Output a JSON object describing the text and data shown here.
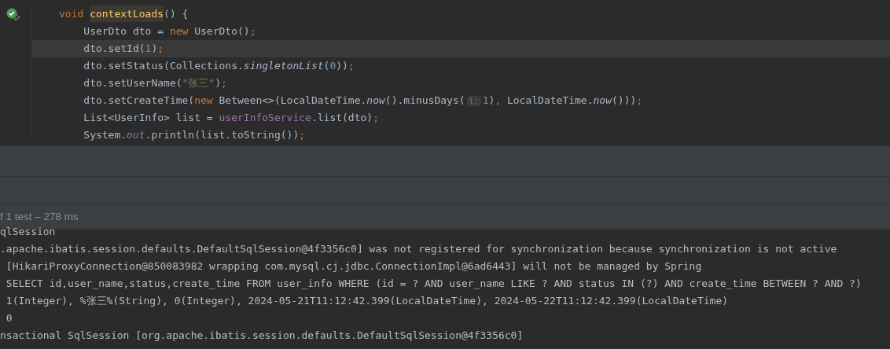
{
  "editor": {
    "gutter_icon": {
      "passed": true
    },
    "lines": [
      {
        "current": false,
        "tokens": [
          {
            "kind": "keyword",
            "text": "void "
          },
          {
            "kind": "highlight",
            "text": "contextLoads"
          },
          {
            "kind": "plain",
            "text": "() {"
          }
        ]
      },
      {
        "current": false,
        "tokens": [
          {
            "kind": "plain",
            "text": "    UserDto dto = "
          },
          {
            "kind": "keyword",
            "text": "new "
          },
          {
            "kind": "plain",
            "text": "UserDto()"
          },
          {
            "kind": "keyword",
            "text": ";"
          }
        ]
      },
      {
        "current": true,
        "tokens": [
          {
            "kind": "plain",
            "text": "    dto.setId("
          },
          {
            "kind": "number",
            "text": "1"
          },
          {
            "kind": "plain",
            "text": ")"
          },
          {
            "kind": "keyword",
            "text": ";"
          }
        ]
      },
      {
        "current": false,
        "tokens": [
          {
            "kind": "plain",
            "text": "    dto.setStatus(Collections."
          },
          {
            "kind": "italic",
            "text": "singletonList"
          },
          {
            "kind": "plain",
            "text": "("
          },
          {
            "kind": "number",
            "text": "0"
          },
          {
            "kind": "plain",
            "text": "))"
          },
          {
            "kind": "keyword",
            "text": ";"
          }
        ]
      },
      {
        "current": false,
        "tokens": [
          {
            "kind": "plain",
            "text": "    dto.setUserName("
          },
          {
            "kind": "string",
            "text": "\"张三\""
          },
          {
            "kind": "plain",
            "text": ")"
          },
          {
            "kind": "keyword",
            "text": ";"
          }
        ]
      },
      {
        "current": false,
        "tokens": [
          {
            "kind": "plain",
            "text": "    dto.setCreateTime("
          },
          {
            "kind": "keyword",
            "text": "new "
          },
          {
            "kind": "plain",
            "text": "Between<>(LocalDateTime."
          },
          {
            "kind": "italic",
            "text": "now"
          },
          {
            "kind": "plain",
            "text": "().minusDays("
          },
          {
            "kind": "hint",
            "text": "l:"
          },
          {
            "kind": "number",
            "text": "1"
          },
          {
            "kind": "plain",
            "text": ")"
          },
          {
            "kind": "keyword",
            "text": ", "
          },
          {
            "kind": "plain",
            "text": "LocalDateTime."
          },
          {
            "kind": "italic",
            "text": "now"
          },
          {
            "kind": "plain",
            "text": "()))"
          },
          {
            "kind": "keyword",
            "text": ";"
          }
        ]
      },
      {
        "current": false,
        "tokens": [
          {
            "kind": "plain",
            "text": "    List<UserInfo> list = "
          },
          {
            "kind": "field",
            "text": "userInfoService"
          },
          {
            "kind": "plain",
            "text": ".list(dto)"
          },
          {
            "kind": "keyword",
            "text": ";"
          }
        ]
      },
      {
        "current": false,
        "tokens": [
          {
            "kind": "plain",
            "text": "    System."
          },
          {
            "kind": "field-italic",
            "text": "out"
          },
          {
            "kind": "plain",
            "text": ".println(list.toString())"
          },
          {
            "kind": "keyword",
            "text": ";"
          }
        ]
      }
    ]
  },
  "test_status": "f 1 test – 278 ms",
  "console": [
    "qlSession",
    ".apache.ibatis.session.defaults.DefaultSqlSession@4f3356c0] was not registered for synchronization because synchronization is not active",
    " [HikariProxyConnection@850083982 wrapping com.mysql.cj.jdbc.ConnectionImpl@6ad6443] will not be managed by Spring",
    " SELECT id,user_name,status,create_time FROM user_info WHERE (id = ? AND user_name LIKE ? AND status IN (?) AND create_time BETWEEN ? AND ?)",
    " 1(Integer), %张三%(String), 0(Integer), 2024-05-21T11:12:42.399(LocalDateTime), 2024-05-22T11:12:42.399(LocalDateTime)",
    " 0",
    "nsactional SqlSession [org.apache.ibatis.session.defaults.DefaultSqlSession@4f3356c0]"
  ]
}
